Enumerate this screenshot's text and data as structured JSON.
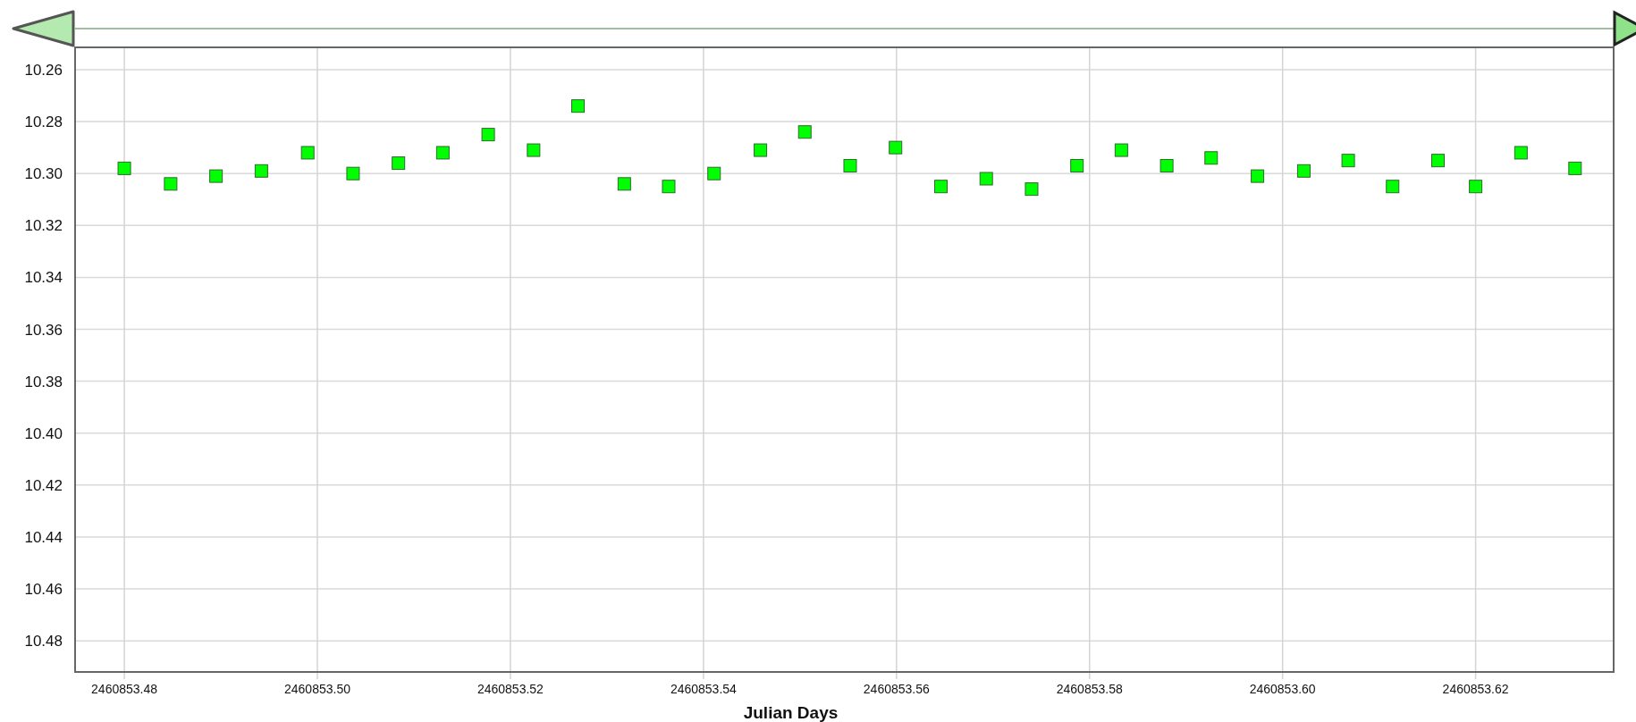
{
  "chart": {
    "chart_data": {
      "type": "scatter",
      "xlabel": "Julian Days",
      "grid": true,
      "x": [
        2460853.48,
        2460853.4848,
        2460853.4895,
        2460853.4942,
        2460853.499,
        2460853.5037,
        2460853.5084,
        2460853.513,
        2460853.5177,
        2460853.5224,
        2460853.527,
        2460853.5318,
        2460853.5364,
        2460853.5411,
        2460853.5459,
        2460853.5505,
        2460853.5552,
        2460853.5599,
        2460853.5646,
        2460853.5693,
        2460853.574,
        2460853.5787,
        2460853.5833,
        2460853.588,
        2460853.5926,
        2460853.5974,
        2460853.6022,
        2460853.6068,
        2460853.6114,
        2460853.6161,
        2460853.62,
        2460853.6247,
        2460853.6303
      ],
      "series": [
        {
          "color": "#00ff00",
          "values": [
            10.298,
            10.304,
            10.301,
            10.299,
            10.292,
            10.3,
            10.296,
            10.292,
            10.285,
            10.291,
            10.274,
            10.304,
            10.305,
            10.3,
            10.291,
            10.284,
            10.297,
            10.29,
            10.305,
            10.302,
            10.306,
            10.297,
            10.291,
            10.297,
            10.294,
            10.301,
            10.299,
            10.295,
            10.305,
            10.295,
            10.305,
            10.292,
            10.298
          ]
        }
      ],
      "xlim": [
        2460853.4749,
        2460853.6343
      ],
      "ylim": [
        10.492,
        10.2514
      ],
      "xticks": [
        {
          "value": 2460853.48,
          "label": "2460853.48"
        },
        {
          "value": 2460853.5,
          "label": "2460853.50"
        },
        {
          "value": 2460853.52,
          "label": "2460853.52"
        },
        {
          "value": 2460853.54,
          "label": "2460853.54"
        },
        {
          "value": 2460853.56,
          "label": "2460853.56"
        },
        {
          "value": 2460853.58,
          "label": "2460853.58"
        },
        {
          "value": 2460853.6,
          "label": "2460853.60"
        },
        {
          "value": 2460853.62,
          "label": "2460853.62"
        }
      ],
      "yticks": [
        {
          "value": 10.26,
          "label": "10.26"
        },
        {
          "value": 10.28,
          "label": "10.28"
        },
        {
          "value": 10.3,
          "label": "10.30"
        },
        {
          "value": 10.32,
          "label": "10.32"
        },
        {
          "value": 10.34,
          "label": "10.34"
        },
        {
          "value": 10.36,
          "label": "10.36"
        },
        {
          "value": 10.38,
          "label": "10.38"
        },
        {
          "value": 10.4,
          "label": "10.40"
        },
        {
          "value": 10.42,
          "label": "10.42"
        },
        {
          "value": 10.44,
          "label": "10.44"
        },
        {
          "value": 10.46,
          "label": "10.46"
        },
        {
          "value": 10.48,
          "label": "10.48"
        }
      ]
    }
  }
}
